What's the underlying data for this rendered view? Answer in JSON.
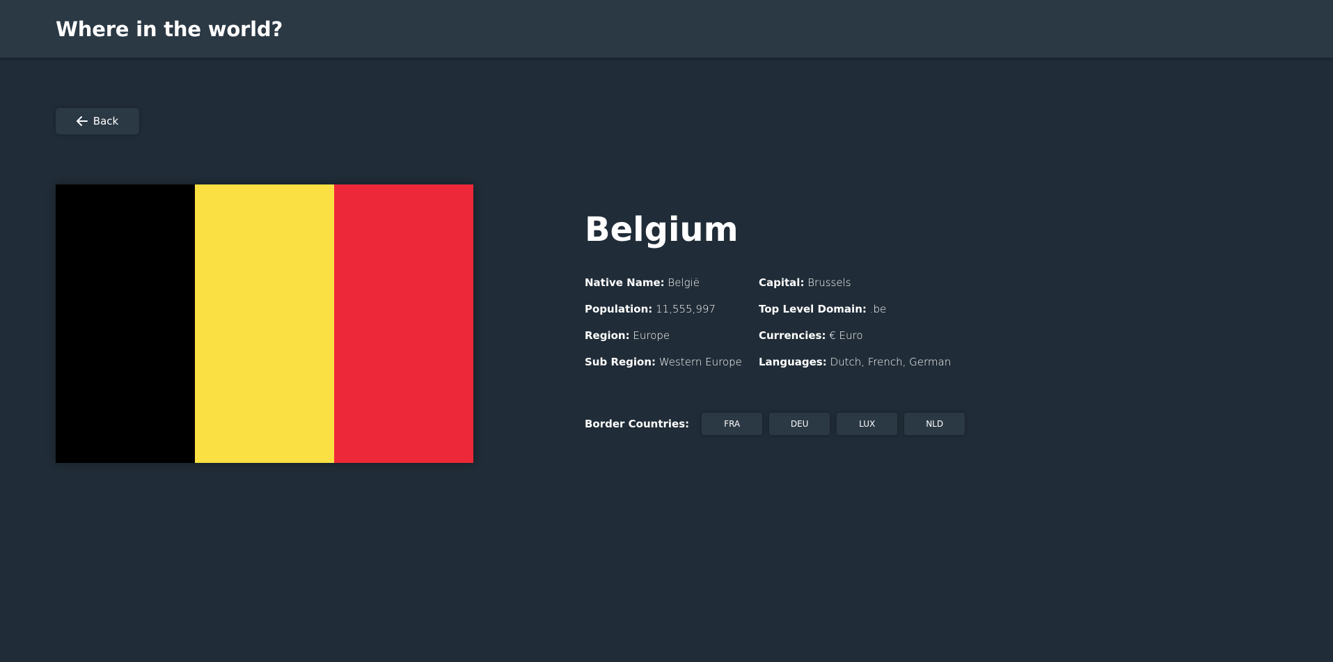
{
  "app": {
    "title": "Where in the world?"
  },
  "navigation": {
    "back_label": "Back"
  },
  "country": {
    "name": "Belgium",
    "flag_colors": [
      "#000000",
      "#fae042",
      "#ed2939"
    ],
    "details_left": [
      {
        "label": "Native Name:",
        "value": "België"
      },
      {
        "label": "Population:",
        "value": "11,555,997"
      },
      {
        "label": "Region:",
        "value": "Europe"
      },
      {
        "label": "Sub Region:",
        "value": "Western Europe"
      }
    ],
    "details_right": [
      {
        "label": "Capital:",
        "value": "Brussels"
      },
      {
        "label": "Top Level Domain:",
        "value": ".be"
      },
      {
        "label": "Currencies:",
        "value": "€ Euro"
      },
      {
        "label": "Languages:",
        "value": "Dutch, French, German"
      }
    ],
    "borders_label": "Border Countries:",
    "borders": [
      "FRA",
      "DEU",
      "LUX",
      "NLD"
    ]
  },
  "theme": {
    "background": "#202c37",
    "element": "#2b3945",
    "text": "#ffffff"
  }
}
